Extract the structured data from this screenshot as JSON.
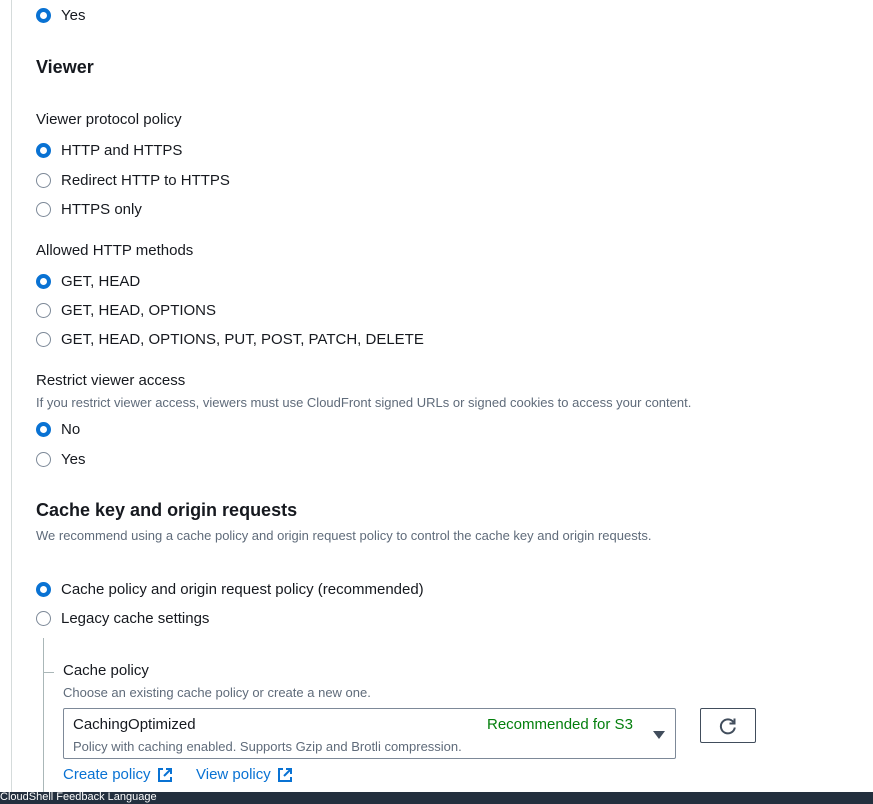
{
  "top_option": {
    "label": "Yes",
    "checked": true
  },
  "viewer": {
    "heading": "Viewer",
    "protocol_policy": {
      "label": "Viewer protocol policy",
      "options": [
        {
          "label": "HTTP and HTTPS",
          "checked": true
        },
        {
          "label": "Redirect HTTP to HTTPS",
          "checked": false
        },
        {
          "label": "HTTPS only",
          "checked": false
        }
      ]
    },
    "allowed_methods": {
      "label": "Allowed HTTP methods",
      "options": [
        {
          "label": "GET, HEAD",
          "checked": true
        },
        {
          "label": "GET, HEAD, OPTIONS",
          "checked": false
        },
        {
          "label": "GET, HEAD, OPTIONS, PUT, POST, PATCH, DELETE",
          "checked": false
        }
      ]
    },
    "restrict_access": {
      "label": "Restrict viewer access",
      "description": "If you restrict viewer access, viewers must use CloudFront signed URLs or signed cookies to access your content.",
      "options": [
        {
          "label": "No",
          "checked": true
        },
        {
          "label": "Yes",
          "checked": false
        }
      ]
    }
  },
  "cache": {
    "heading": "Cache key and origin requests",
    "description": "We recommend using a cache policy and origin request policy to control the cache key and origin requests.",
    "options": [
      {
        "label": "Cache policy and origin request policy (recommended)",
        "checked": true
      },
      {
        "label": "Legacy cache settings",
        "checked": false
      }
    ],
    "cache_policy": {
      "label": "Cache policy",
      "description": "Choose an existing cache policy or create a new one.",
      "selected_value": "CachingOptimized",
      "selected_tag": "Recommended for S3",
      "selected_description": "Policy with caching enabled. Supports Gzip and Brotli compression.",
      "create_link": "Create policy",
      "view_link": "View policy"
    }
  },
  "footer": {
    "text": "CloudShell   Feedback   Language"
  },
  "colors": {
    "accent": "#0972d3",
    "tag_green": "#037f0c",
    "footer_bg": "#232f3e"
  },
  "icons": [
    "external-link-icon",
    "refresh-icon",
    "caret-down-icon"
  ]
}
